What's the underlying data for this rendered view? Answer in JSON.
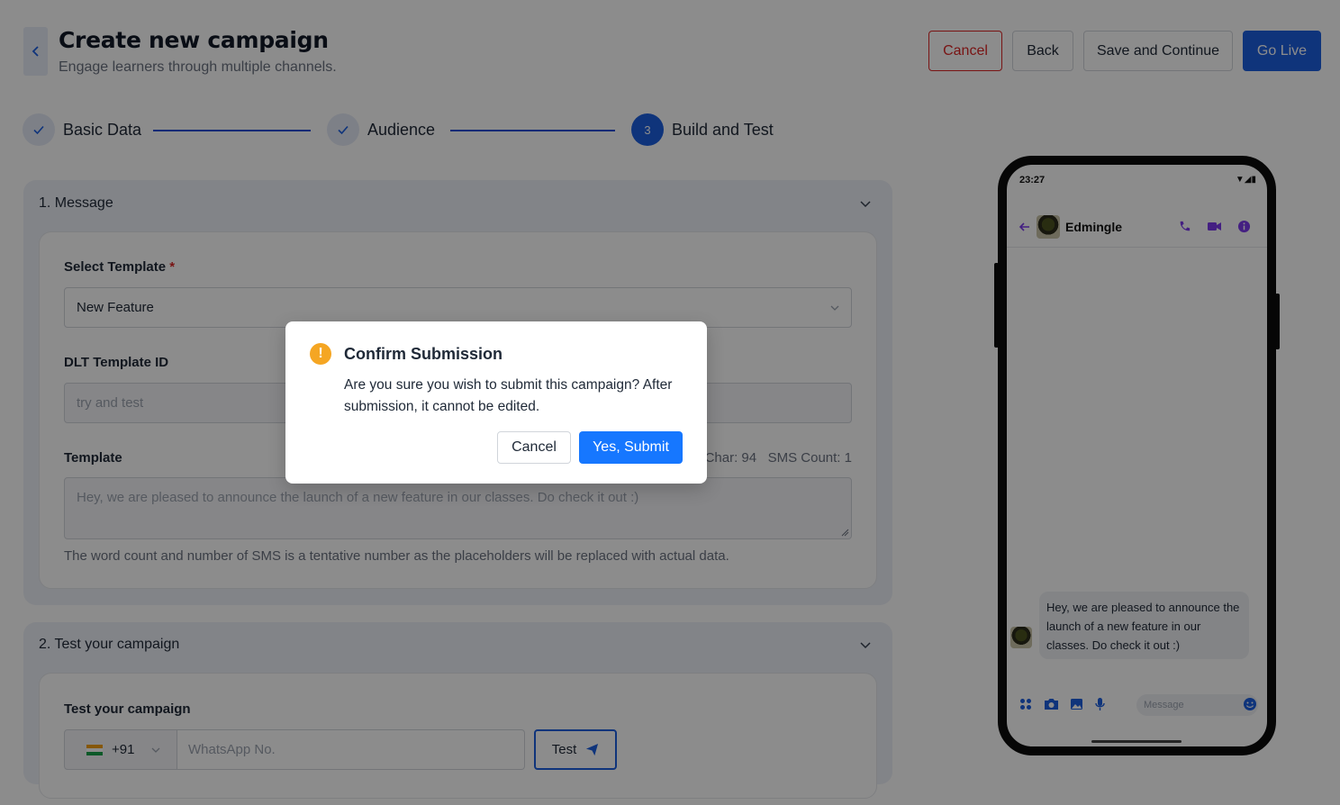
{
  "header": {
    "title": "Create new campaign",
    "subtitle": "Engage learners through multiple channels.",
    "buttons": {
      "cancel": "Cancel",
      "back": "Back",
      "save": "Save and Continue",
      "go_live": "Go Live"
    }
  },
  "stepper": {
    "steps": [
      {
        "label": "Basic Data",
        "status": "done"
      },
      {
        "label": "Audience",
        "status": "done"
      },
      {
        "label": "Build and Test",
        "status": "active",
        "number": "3"
      }
    ]
  },
  "message_section": {
    "title": "1. Message",
    "select_template_label": "Select Template",
    "required_mark": "*",
    "select_template_value": "New Feature",
    "dlt_label": "DLT Template ID",
    "dlt_value": "try and test",
    "template_label": "Template",
    "counts": "Char: 94   SMS Count: 1",
    "template_text": "Hey, we are pleased to announce the launch of a new feature in our classes. Do check it out :)",
    "hint": "The word count and number of SMS is a tentative number as the placeholders will be replaced with actual data."
  },
  "test_section": {
    "title": "2. Test your campaign",
    "field_label": "Test your campaign",
    "country_code": "+91",
    "phone_placeholder": "WhatsApp No.",
    "test_button": "Test"
  },
  "phone_preview": {
    "time": "23:27",
    "contact_name": "Edmingle",
    "message": "Hey, we are pleased to announce the launch of a new feature in our classes. Do check it out :)",
    "input_placeholder": "Message"
  },
  "modal": {
    "title": "Confirm Submission",
    "body": "Are you sure you wish to submit this campaign? After submission, it cannot be edited.",
    "cancel": "Cancel",
    "confirm": "Yes, Submit"
  },
  "colors": {
    "primary": "#1d5fe0",
    "danger": "#dc2626",
    "warning": "#f5a623",
    "modal_primary": "#1677ff",
    "whatsapp_accent": "#7c3aed"
  }
}
